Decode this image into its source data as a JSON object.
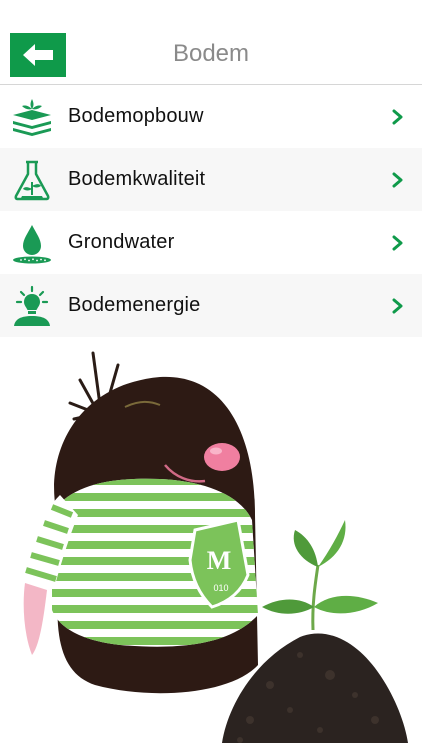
{
  "header": {
    "title": "Bodem",
    "back_icon": "arrow-left-icon",
    "accent": "#0f9a4a"
  },
  "menu": {
    "items": [
      {
        "label": "Bodemopbouw",
        "icon": "soil-layers-icon"
      },
      {
        "label": "Bodemkwaliteit",
        "icon": "flask-plant-icon"
      },
      {
        "label": "Grondwater",
        "icon": "water-drop-icon"
      },
      {
        "label": "Bodemenergie",
        "icon": "lightbulb-person-icon"
      }
    ],
    "chevron_icon": "chevron-right-icon"
  },
  "illustration": {
    "shirt_logo": "M",
    "shirt_logo_sub": "010"
  }
}
